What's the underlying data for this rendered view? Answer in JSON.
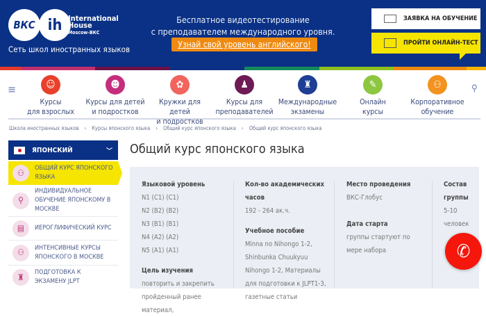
{
  "header": {
    "logo": {
      "vkc": "ВКС",
      "ih": "ih",
      "name_line1": "International",
      "name_line2": "House",
      "name_line3": "Moscow-ВКС"
    },
    "tagline": "Сеть школ иностранных языков",
    "promo_line1": "Бесплатное видеотестирование",
    "promo_line2": "с преподавателем международного уровня.",
    "promo_button": "Узнай свой уровень английского!",
    "apply_button": "ЗАЯВКА НА ОБУЧЕНИЕ",
    "test_button": "ПРОЙТИ ОНЛАЙН-ТЕСТ"
  },
  "nav": {
    "items": [
      {
        "line1": "Курсы",
        "line2": "для взрослых",
        "color": "#e8402a",
        "icon": "adult-icon"
      },
      {
        "line1": "Курсы для детей",
        "line2": "и подростков",
        "color": "#c42e7c",
        "icon": "kid-icon"
      },
      {
        "line1": "Кружки для детей",
        "line2": "и подростков",
        "color": "#f2645e",
        "icon": "clubs-icon"
      },
      {
        "line1": "Курсы для",
        "line2": "преподавателей",
        "color": "#6e1a55",
        "icon": "teacher-icon"
      },
      {
        "line1": "Международные",
        "line2": "экзамены",
        "color": "#1e3f94",
        "icon": "big-ben-icon"
      },
      {
        "line1": "Онлайн",
        "line2": "курсы",
        "color": "#8dc63f",
        "icon": "online-icon"
      },
      {
        "line1": "Корпоративное",
        "line2": "обучение",
        "color": "#f39221",
        "icon": "corporate-icon"
      }
    ]
  },
  "breadcrumb": [
    "Школа иностранных языков",
    "Курсы японского языка",
    "Общий курс японского языка",
    "Общий курс японского языка"
  ],
  "sidebar": {
    "language": "ЯПОНСКИЙ",
    "items": [
      "Общий курс японского языка",
      "Индивидуальное обучение японскому в Москве",
      "Иероглифический курс",
      "Интенсивные курсы японского в Москве",
      "Подготовка к экзамену JLPT"
    ]
  },
  "main": {
    "title": "Общий курс японского языка",
    "level_label": "Языковой уровень",
    "levels": [
      "N1 (C1) (C1)",
      "N2 (B2) (B2)",
      "N3 (B1) (B1)",
      "N4 (A2) (A2)",
      "N5 (A1) (A1)"
    ],
    "goal_label": "Цель изучения",
    "goal_lines": [
      "повторить и закрепить",
      "пройденный ранее",
      "материал,"
    ],
    "hours_label_1": "Кол-во академических",
    "hours_label_2": "часов",
    "hours": "192 - 264 ак.ч.",
    "books_label": "Учебное пособие",
    "books_lines": [
      "Minna no Nihongo 1-2,",
      "Shinbunka Chuukyuu",
      "Nihongo 1-2, Материалы",
      "для подготовки к JLPT1-3,",
      "газетные статьи"
    ],
    "place_label": "Место проведения",
    "place": "ВКС-Глобус",
    "start_label": "Дата старта",
    "start_lines": [
      "группы стартуют по",
      "мере набора"
    ],
    "group_label_1": "Состав",
    "group_label_2": "группы",
    "group_lines": [
      "5-10",
      "человек"
    ]
  }
}
